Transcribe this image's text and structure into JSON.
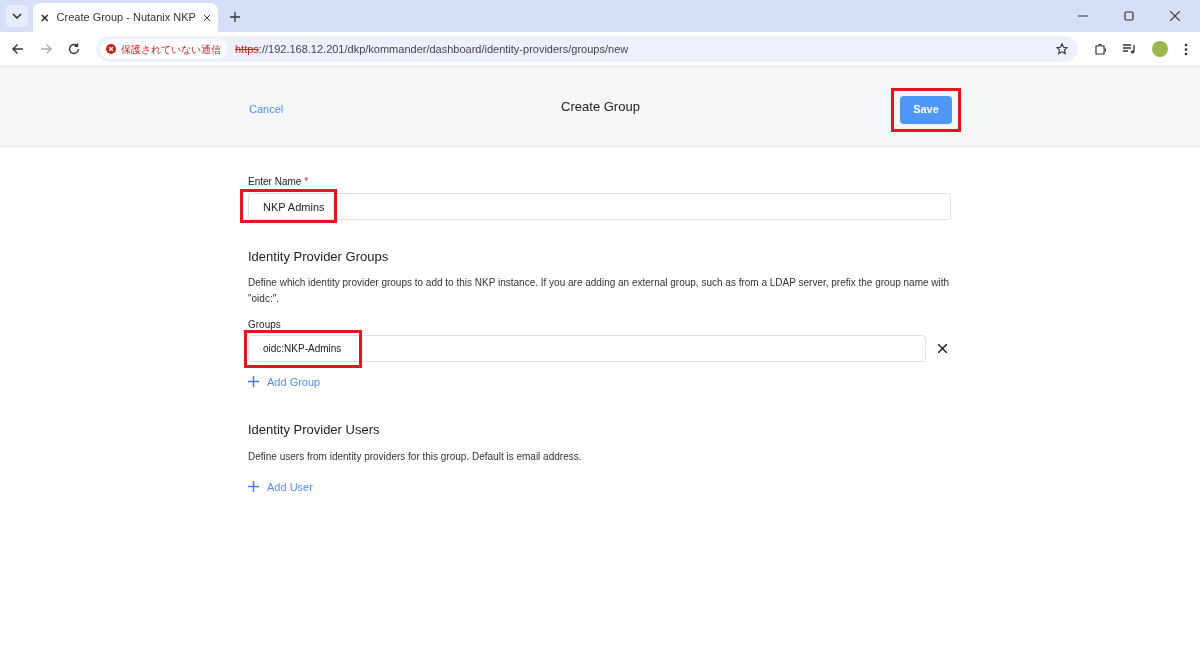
{
  "browser": {
    "tab_title": "Create Group - Nutanix NKP",
    "security_label": "保護されていない通信",
    "url_scheme": "https",
    "url_rest": "://192.168.12.201/dkp/kommander/dashboard/identity-providers/groups/new"
  },
  "header": {
    "cancel": "Cancel",
    "title": "Create Group",
    "save": {
      "label": "Save",
      "highlighted": true
    }
  },
  "name_field": {
    "label": "Enter Name",
    "required_mark": "*",
    "value": "NKP Admins",
    "highlighted": true
  },
  "groups_section": {
    "heading": "Identity Provider Groups",
    "description": "Define which identity provider groups to add to this NKP instance. If you are adding an external group, such as from a LDAP server, prefix the group name with \"oidc:\".",
    "field_label": "Groups",
    "groups": [
      {
        "value": "oidc:NKP-Admins",
        "highlighted": true
      }
    ],
    "add_label": "Add Group"
  },
  "users_section": {
    "heading": "Identity Provider Users",
    "description": "Define users from identity providers for this group. Default is email address.",
    "add_label": "Add User"
  }
}
